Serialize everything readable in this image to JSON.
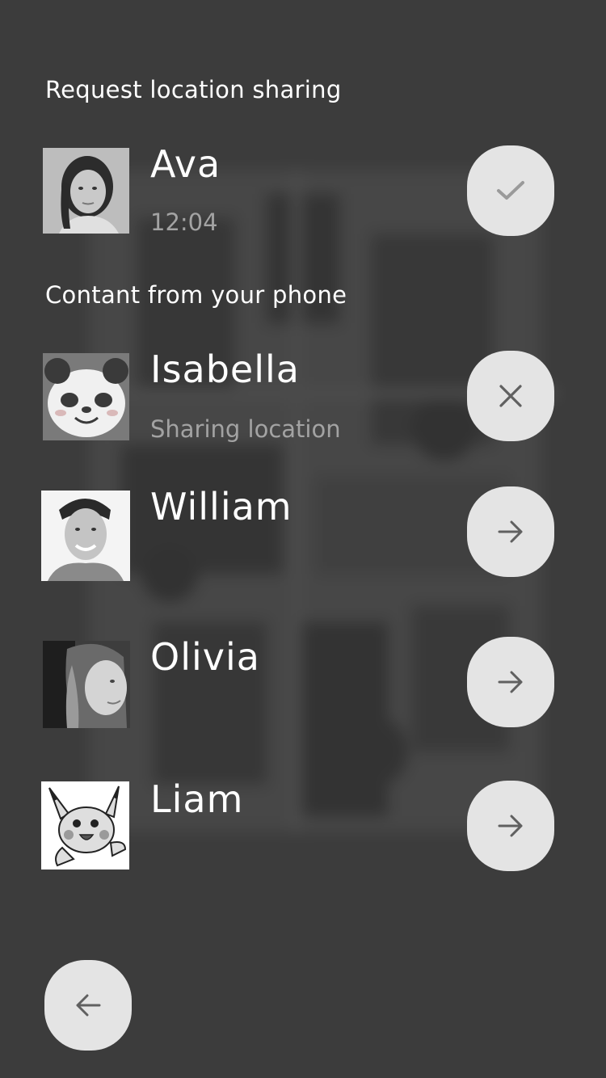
{
  "sections": {
    "request_title": "Request location sharing",
    "contacts_title": "Contant from your phone"
  },
  "request": {
    "name": "Ava",
    "time": "12:04",
    "action_icon": "check-icon"
  },
  "contacts": [
    {
      "name": "Isabella",
      "status": "Sharing location",
      "action_icon": "close-icon",
      "avatar": "panda"
    },
    {
      "name": "William",
      "status": "",
      "action_icon": "arrow-right-icon",
      "avatar": "photo-man"
    },
    {
      "name": "Olivia",
      "status": "",
      "action_icon": "arrow-right-icon",
      "avatar": "photo-woman"
    },
    {
      "name": "Liam",
      "status": "",
      "action_icon": "arrow-right-icon",
      "avatar": "pikachu"
    }
  ],
  "footer": {
    "back_icon": "arrow-left-icon"
  },
  "colors": {
    "background": "#3c3c3c",
    "button": "#e4e4e4",
    "icon": "#606060",
    "subtext": "#a3a3a3"
  }
}
